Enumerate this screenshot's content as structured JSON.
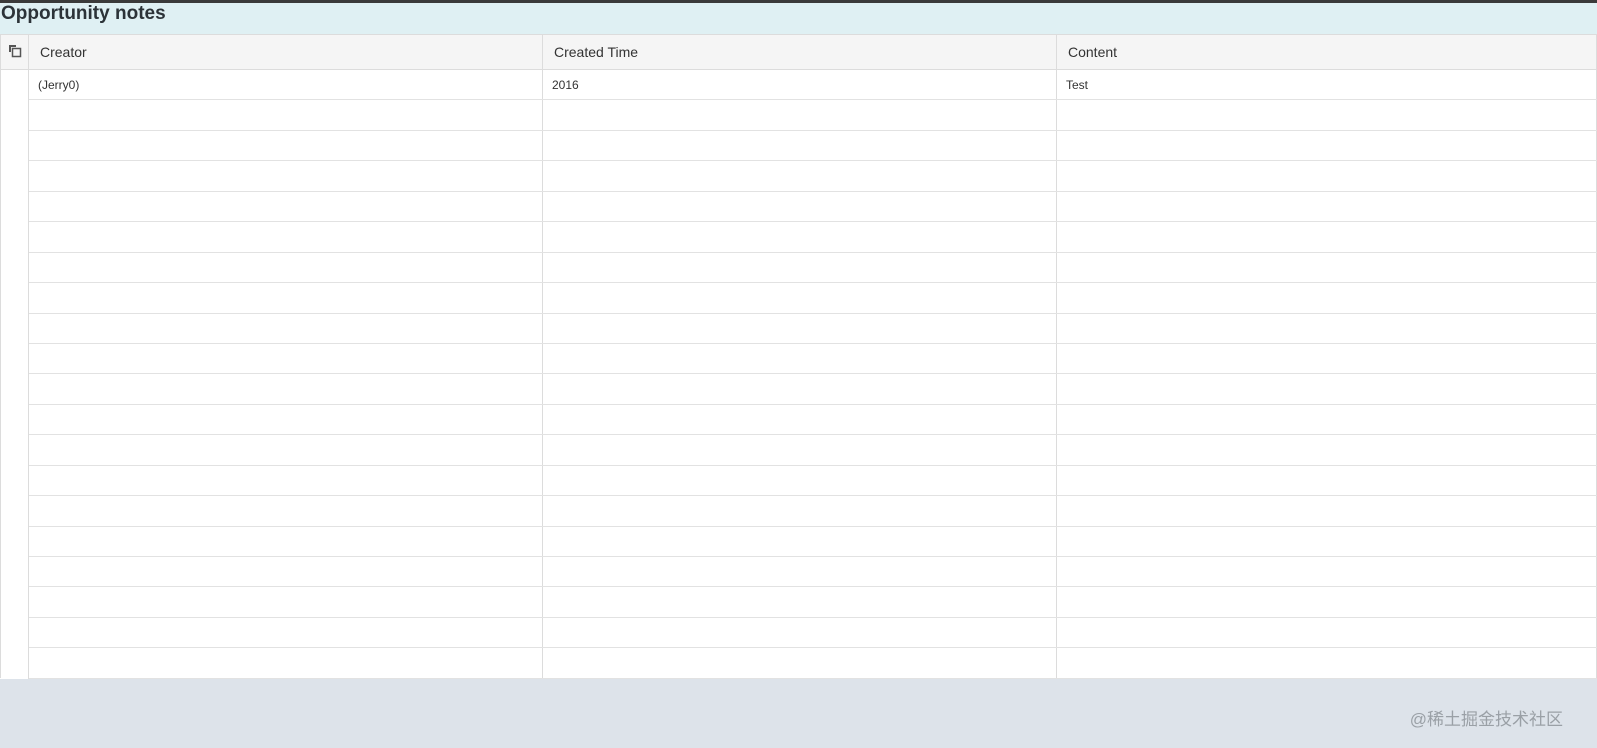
{
  "title": "Opportunity notes",
  "columns": [
    "Creator",
    "Created Time",
    "Content"
  ],
  "rows": [
    {
      "creator": "(Jerry0)",
      "created_time": "2016",
      "content": "Test"
    }
  ],
  "empty_rows": 19,
  "watermark": "@稀土掘金技术社区"
}
